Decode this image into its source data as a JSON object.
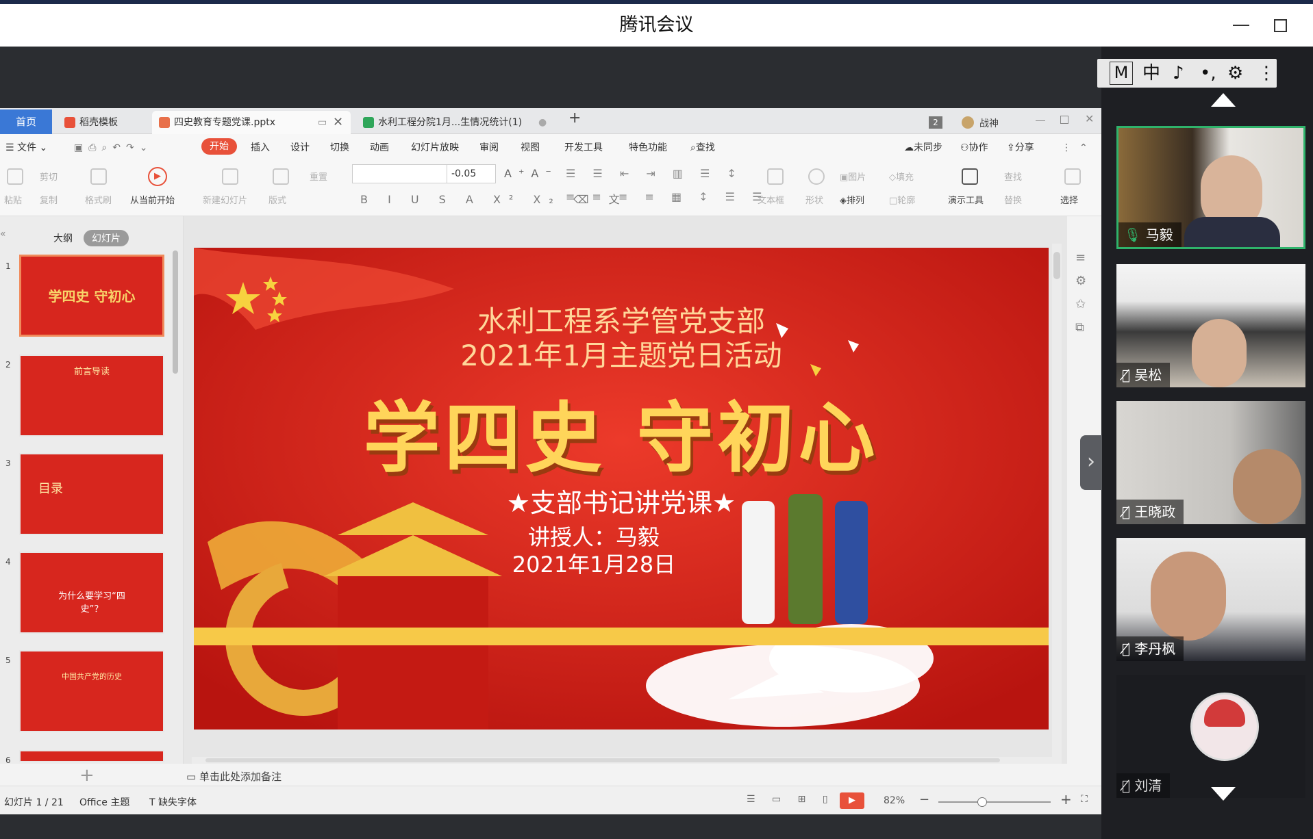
{
  "meeting": {
    "title": "腾讯会议"
  },
  "ime_bar": {
    "items": [
      "M",
      "中",
      "♪",
      "•,",
      "⚙",
      "⋮"
    ]
  },
  "wps": {
    "tabs": [
      {
        "label": "首页"
      },
      {
        "label": "稻壳模板"
      },
      {
        "label": "四史教育专题党课.pptx"
      },
      {
        "label": "水利工程分院1月...生情况统计(1)"
      }
    ],
    "add_tab": "+",
    "window_count": "2",
    "user": "战神",
    "menu": {
      "file": "文件",
      "items": [
        "开始",
        "插入",
        "设计",
        "切换",
        "动画",
        "幻灯片放映",
        "审阅",
        "视图",
        "开发工具",
        "特色功能"
      ],
      "search": "查找",
      "right": [
        "未同步",
        "协作",
        "分享"
      ]
    },
    "ribbon": {
      "paste": "粘贴",
      "cut": "剪切",
      "copy": "复制",
      "format_painter": "格式刷",
      "play_from_current": "从当前开始",
      "new_slide": "新建幻灯片",
      "layout": "版式",
      "reset": "重置",
      "font_size": "-0.05",
      "textbox": "文本框",
      "shape": "形状",
      "image": "图片",
      "arrange": "排列",
      "fill": "填充",
      "outline": "轮廓",
      "present_tools": "演示工具",
      "find": "查找",
      "replace": "替换",
      "select": "选择"
    },
    "pane": {
      "outline_tab": "大纲",
      "slides_tab": "幻灯片",
      "thumbs": [
        {
          "num": "1",
          "text": "学四史 守初心"
        },
        {
          "num": "2",
          "text": "前言导读"
        },
        {
          "num": "3",
          "text": "目录"
        },
        {
          "num": "4",
          "text": "为什么要学习“四史”？"
        },
        {
          "num": "5",
          "text": "中国共产党的历史"
        },
        {
          "num": "6",
          "text": ""
        }
      ],
      "add": "+"
    },
    "slide": {
      "line1": "水利工程系学管党支部",
      "line2": "2021年1月主题党日活动",
      "headline": "学四史 守初心",
      "subtitle": "★支部书记讲党课★",
      "lecturer": "讲授人：马毅",
      "date": "2021年1月28日"
    },
    "notes_placeholder": "单击此处添加备注",
    "status": {
      "slide_counter": "幻灯片 1 / 21",
      "theme": "Office 主题",
      "missing_font": "缺失字体",
      "zoom": "82%"
    }
  },
  "participants": [
    {
      "name": "马毅",
      "muted": false
    },
    {
      "name": "吴松",
      "muted": true
    },
    {
      "name": "王晓政",
      "muted": true
    },
    {
      "name": "李丹枫",
      "muted": true
    },
    {
      "name": "刘清",
      "muted": true
    }
  ],
  "colors": {
    "slide_red": "#d8231b",
    "gold": "#f7c948",
    "accent_blue": "#3a78d6",
    "start_orange": "#e8513a",
    "speaking_green": "#2fb36b"
  }
}
